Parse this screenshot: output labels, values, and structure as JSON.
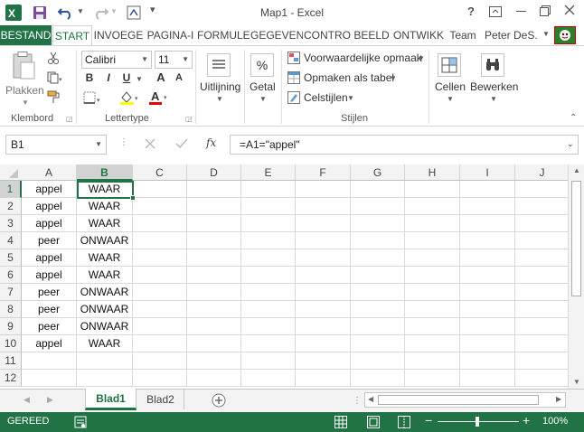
{
  "app": {
    "window_title": "Map1 - Excel",
    "help": "?",
    "user_name": "Peter DeS..."
  },
  "tabs": [
    {
      "label": "BESTAND"
    },
    {
      "label": "START"
    },
    {
      "label": "INVOEGE"
    },
    {
      "label": "PAGINA-I"
    },
    {
      "label": "FORMULE"
    },
    {
      "label": "GEGEVEN"
    },
    {
      "label": "CONTRO"
    },
    {
      "label": "BEELD"
    },
    {
      "label": "ONTWIKK"
    },
    {
      "label": "Team"
    }
  ],
  "ribbon": {
    "paste_label": "Plakken",
    "clipboard_group": "Klembord",
    "font_name": "Calibri",
    "font_size": "11",
    "bold": "B",
    "italic": "I",
    "underline": "U",
    "increase_font": "A",
    "decrease_font": "A",
    "font_color_letter": "A",
    "font_group": "Lettertype",
    "alignment_label": "Uitlijning",
    "number_label": "Getal",
    "percent": "%",
    "conditional_format": "Voorwaardelijke opmaak",
    "format_as_table": "Opmaken als tabel",
    "cell_styles": "Celstijlen",
    "styles_group": "Stijlen",
    "cells_label": "Cellen",
    "edit_label": "Bewerken"
  },
  "formula_bar": {
    "name_box": "B1",
    "fx": "fx",
    "formula": "=A1=\"appel\""
  },
  "grid": {
    "columns": [
      "A",
      "B",
      "C",
      "D",
      "E",
      "F",
      "G",
      "H",
      "I",
      "J"
    ],
    "row_numbers": [
      "1",
      "2",
      "3",
      "4",
      "5",
      "6",
      "7",
      "8",
      "9",
      "10",
      "11",
      "12"
    ],
    "rows": [
      [
        "appel",
        "WAAR"
      ],
      [
        "appel",
        "WAAR"
      ],
      [
        "appel",
        "WAAR"
      ],
      [
        "peer",
        "ONWAAR"
      ],
      [
        "appel",
        "WAAR"
      ],
      [
        "appel",
        "WAAR"
      ],
      [
        "peer",
        "ONWAAR"
      ],
      [
        "peer",
        "ONWAAR"
      ],
      [
        "peer",
        "ONWAAR"
      ],
      [
        "appel",
        "WAAR"
      ],
      [
        "",
        ""
      ],
      [
        "",
        ""
      ]
    ],
    "active_cell": "B1"
  },
  "sheets": [
    {
      "label": "Blad1",
      "active": true
    },
    {
      "label": "Blad2",
      "active": false
    }
  ],
  "status": {
    "mode": "GEREED",
    "zoom": "100%",
    "zoom_minus": "−",
    "zoom_plus": "+"
  },
  "colors": {
    "excel_green": "#217346",
    "accent_text": "#217346"
  }
}
